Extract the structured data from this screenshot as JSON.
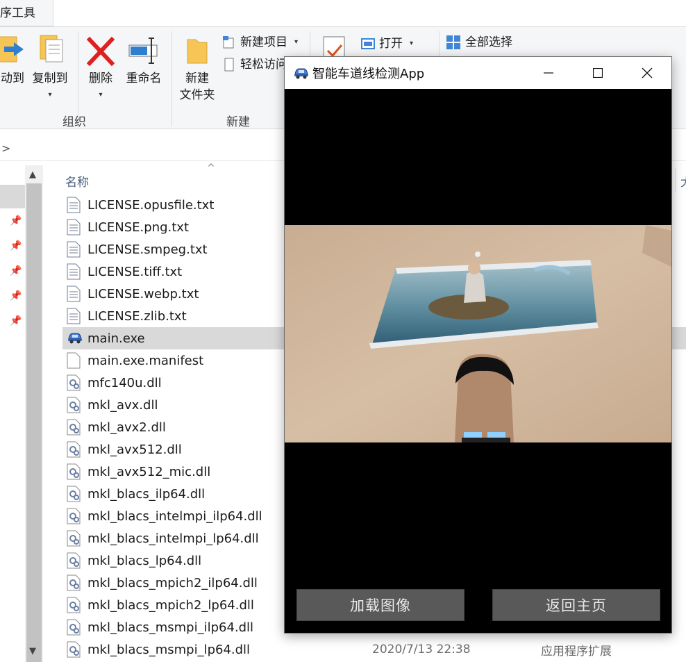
{
  "ribbon": {
    "tab_label": "序工具",
    "move_to": "动到",
    "copy_to": "复制到",
    "delete": "删除",
    "rename": "重命名",
    "new_folder_line1": "新建",
    "new_folder_line2": "文件夹",
    "new_item": "新建项目",
    "easy_access": "轻松访问",
    "open": "打开",
    "select_all": "全部选择",
    "group_organize": "组织",
    "group_new": "新建"
  },
  "address": {
    "chevron": ">"
  },
  "list": {
    "column_name": "名称",
    "column_frag": "大",
    "files": [
      {
        "name": "LICENSE.opusfile.txt",
        "icon": "text-file-icon"
      },
      {
        "name": "LICENSE.png.txt",
        "icon": "text-file-icon"
      },
      {
        "name": "LICENSE.smpeg.txt",
        "icon": "text-file-icon"
      },
      {
        "name": "LICENSE.tiff.txt",
        "icon": "text-file-icon"
      },
      {
        "name": "LICENSE.webp.txt",
        "icon": "text-file-icon"
      },
      {
        "name": "LICENSE.zlib.txt",
        "icon": "text-file-icon"
      },
      {
        "name": "main.exe",
        "icon": "car-app-icon",
        "selected": true
      },
      {
        "name": "main.exe.manifest",
        "icon": "blank-file-icon"
      },
      {
        "name": "mfc140u.dll",
        "icon": "dll-file-icon"
      },
      {
        "name": "mkl_avx.dll",
        "icon": "dll-file-icon"
      },
      {
        "name": "mkl_avx2.dll",
        "icon": "dll-file-icon"
      },
      {
        "name": "mkl_avx512.dll",
        "icon": "dll-file-icon"
      },
      {
        "name": "mkl_avx512_mic.dll",
        "icon": "dll-file-icon"
      },
      {
        "name": "mkl_blacs_ilp64.dll",
        "icon": "dll-file-icon"
      },
      {
        "name": "mkl_blacs_intelmpi_ilp64.dll",
        "icon": "dll-file-icon"
      },
      {
        "name": "mkl_blacs_intelmpi_lp64.dll",
        "icon": "dll-file-icon"
      },
      {
        "name": "mkl_blacs_lp64.dll",
        "icon": "dll-file-icon"
      },
      {
        "name": "mkl_blacs_mpich2_ilp64.dll",
        "icon": "dll-file-icon"
      },
      {
        "name": "mkl_blacs_mpich2_lp64.dll",
        "icon": "dll-file-icon"
      },
      {
        "name": "mkl_blacs_msmpi_ilp64.dll",
        "icon": "dll-file-icon"
      },
      {
        "name": "mkl_blacs_msmpi_lp64.dll",
        "icon": "dll-file-icon",
        "date": "2020/7/13 22:38",
        "type": "应用程序扩展"
      }
    ]
  },
  "app": {
    "title": "智能车道线检测App",
    "load_image_button": "加载图像",
    "back_home_button": "返回主页"
  },
  "colors": {
    "selection": "#d9d9d9",
    "app_button": "#595959",
    "ribbon_bg": "#f5f6f7"
  }
}
